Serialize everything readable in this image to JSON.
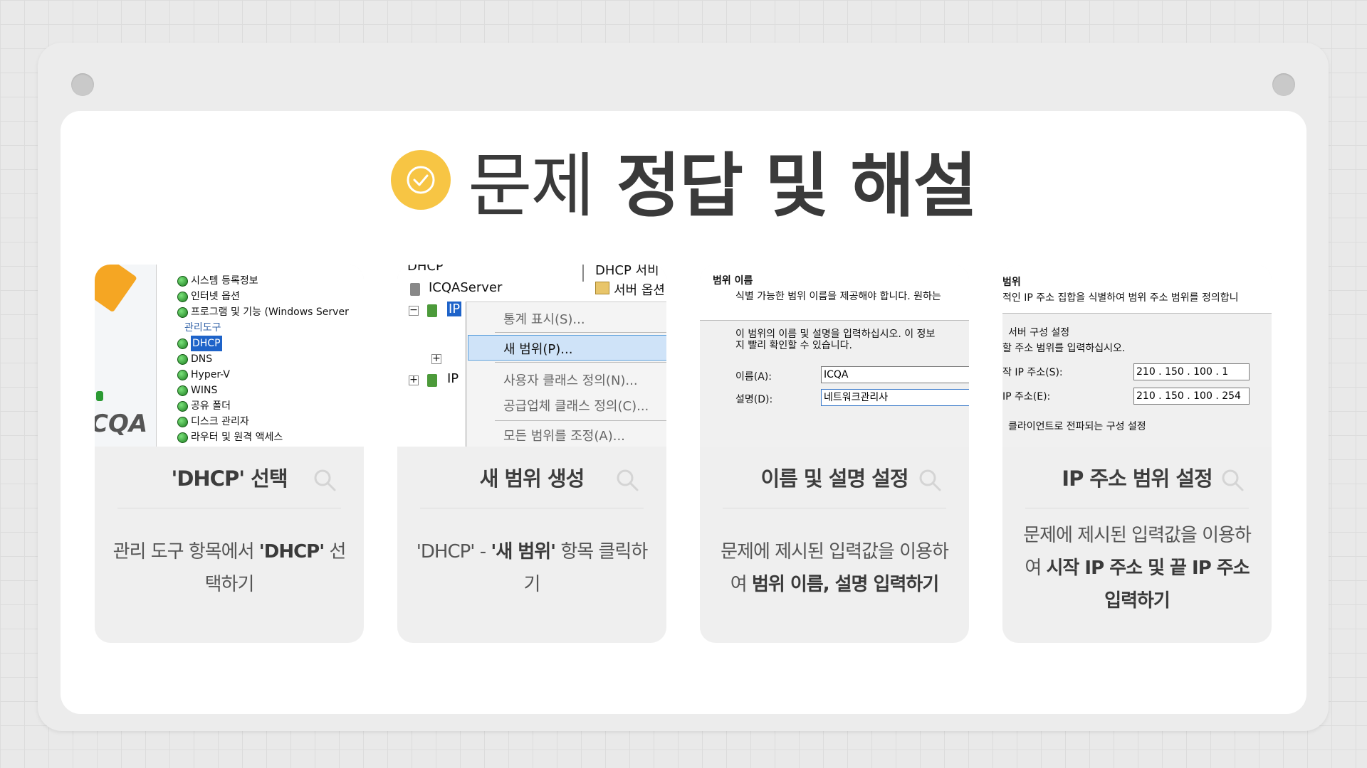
{
  "header": {
    "title_light": "문제",
    "title_bold": "정답 및 해설"
  },
  "colors": {
    "accent": "#f7c544",
    "selection": "#1e63c9"
  },
  "cards": [
    {
      "title": "'DHCP' 선택",
      "desc_1": "관리 도구 항목에서 ",
      "desc_bold": "'DHCP'",
      "desc_2": " 선택하기",
      "thumb": {
        "items": [
          "시스템 등록정보",
          "인터넷 옵션",
          "프로그램 및 기능 (Windows Server"
        ],
        "group": "관리도구",
        "tools": [
          "DHCP",
          "DNS",
          "Hyper-V",
          "WINS",
          "공유 폴더",
          "디스크 관리자",
          "라우터 및 원격 액세스"
        ],
        "logo": "CQA"
      }
    },
    {
      "title": "새 범위 생성",
      "desc_1": "'DHCP' - ",
      "desc_bold": "'새 범위'",
      "desc_2": " 항목 클릭하기",
      "thumb": {
        "root": "DHCP",
        "server": "ICQAServer",
        "node_a": "IP",
        "node_b": "IP",
        "right_head": "DHCP 서비",
        "right_item": "서버 옵션",
        "menu": [
          "통계 표시(S)...",
          "새 범위(P)...",
          "사용자 클래스 정의(N)...",
          "공급업체 클래스 정의(C)...",
          "모든 범위를 조정(A)..."
        ]
      }
    },
    {
      "title": "이름 및 설명 설정",
      "desc_1": "문제에 제시된 입력값을 이용하여 ",
      "desc_bold": "범위 이름, 설명 입력하기",
      "desc_2": "",
      "thumb": {
        "heading": "범위 이름",
        "sub": "식별 가능한 범위 이름을 제공해야 합니다. 원하는",
        "line1": "이 범위의 이름 및 설명을 입력하십시오. 이 정보",
        "line2": "지 빨리 확인할 수 있습니다.",
        "name_label": "이름(A):",
        "name_value": "ICQA",
        "desc_label": "설명(D):",
        "desc_value": "네트워크관리사"
      }
    },
    {
      "title": "IP 주소 범위 설정",
      "desc_1": "문제에 제시된 입력값을 이용하여 ",
      "desc_bold": "시작 IP 주소 및 끝 IP 주소 입력하기",
      "desc_2": "",
      "thumb": {
        "heading": "범위",
        "sub": "적인 IP 주소 집합을 식별하여 범위 주소 범위를 정의합니",
        "section": "서버 구성 설정",
        "line1": "할 주소 범위를 입력하십시오.",
        "start_label": "작 IP 주소(S):",
        "start_value": "210 . 150 . 100 .   1",
        "end_label": "IP 주소(E):",
        "end_value": "210 . 150 . 100 . 254",
        "footer": "클라이언트로 전파되는 구성 설정"
      }
    }
  ]
}
